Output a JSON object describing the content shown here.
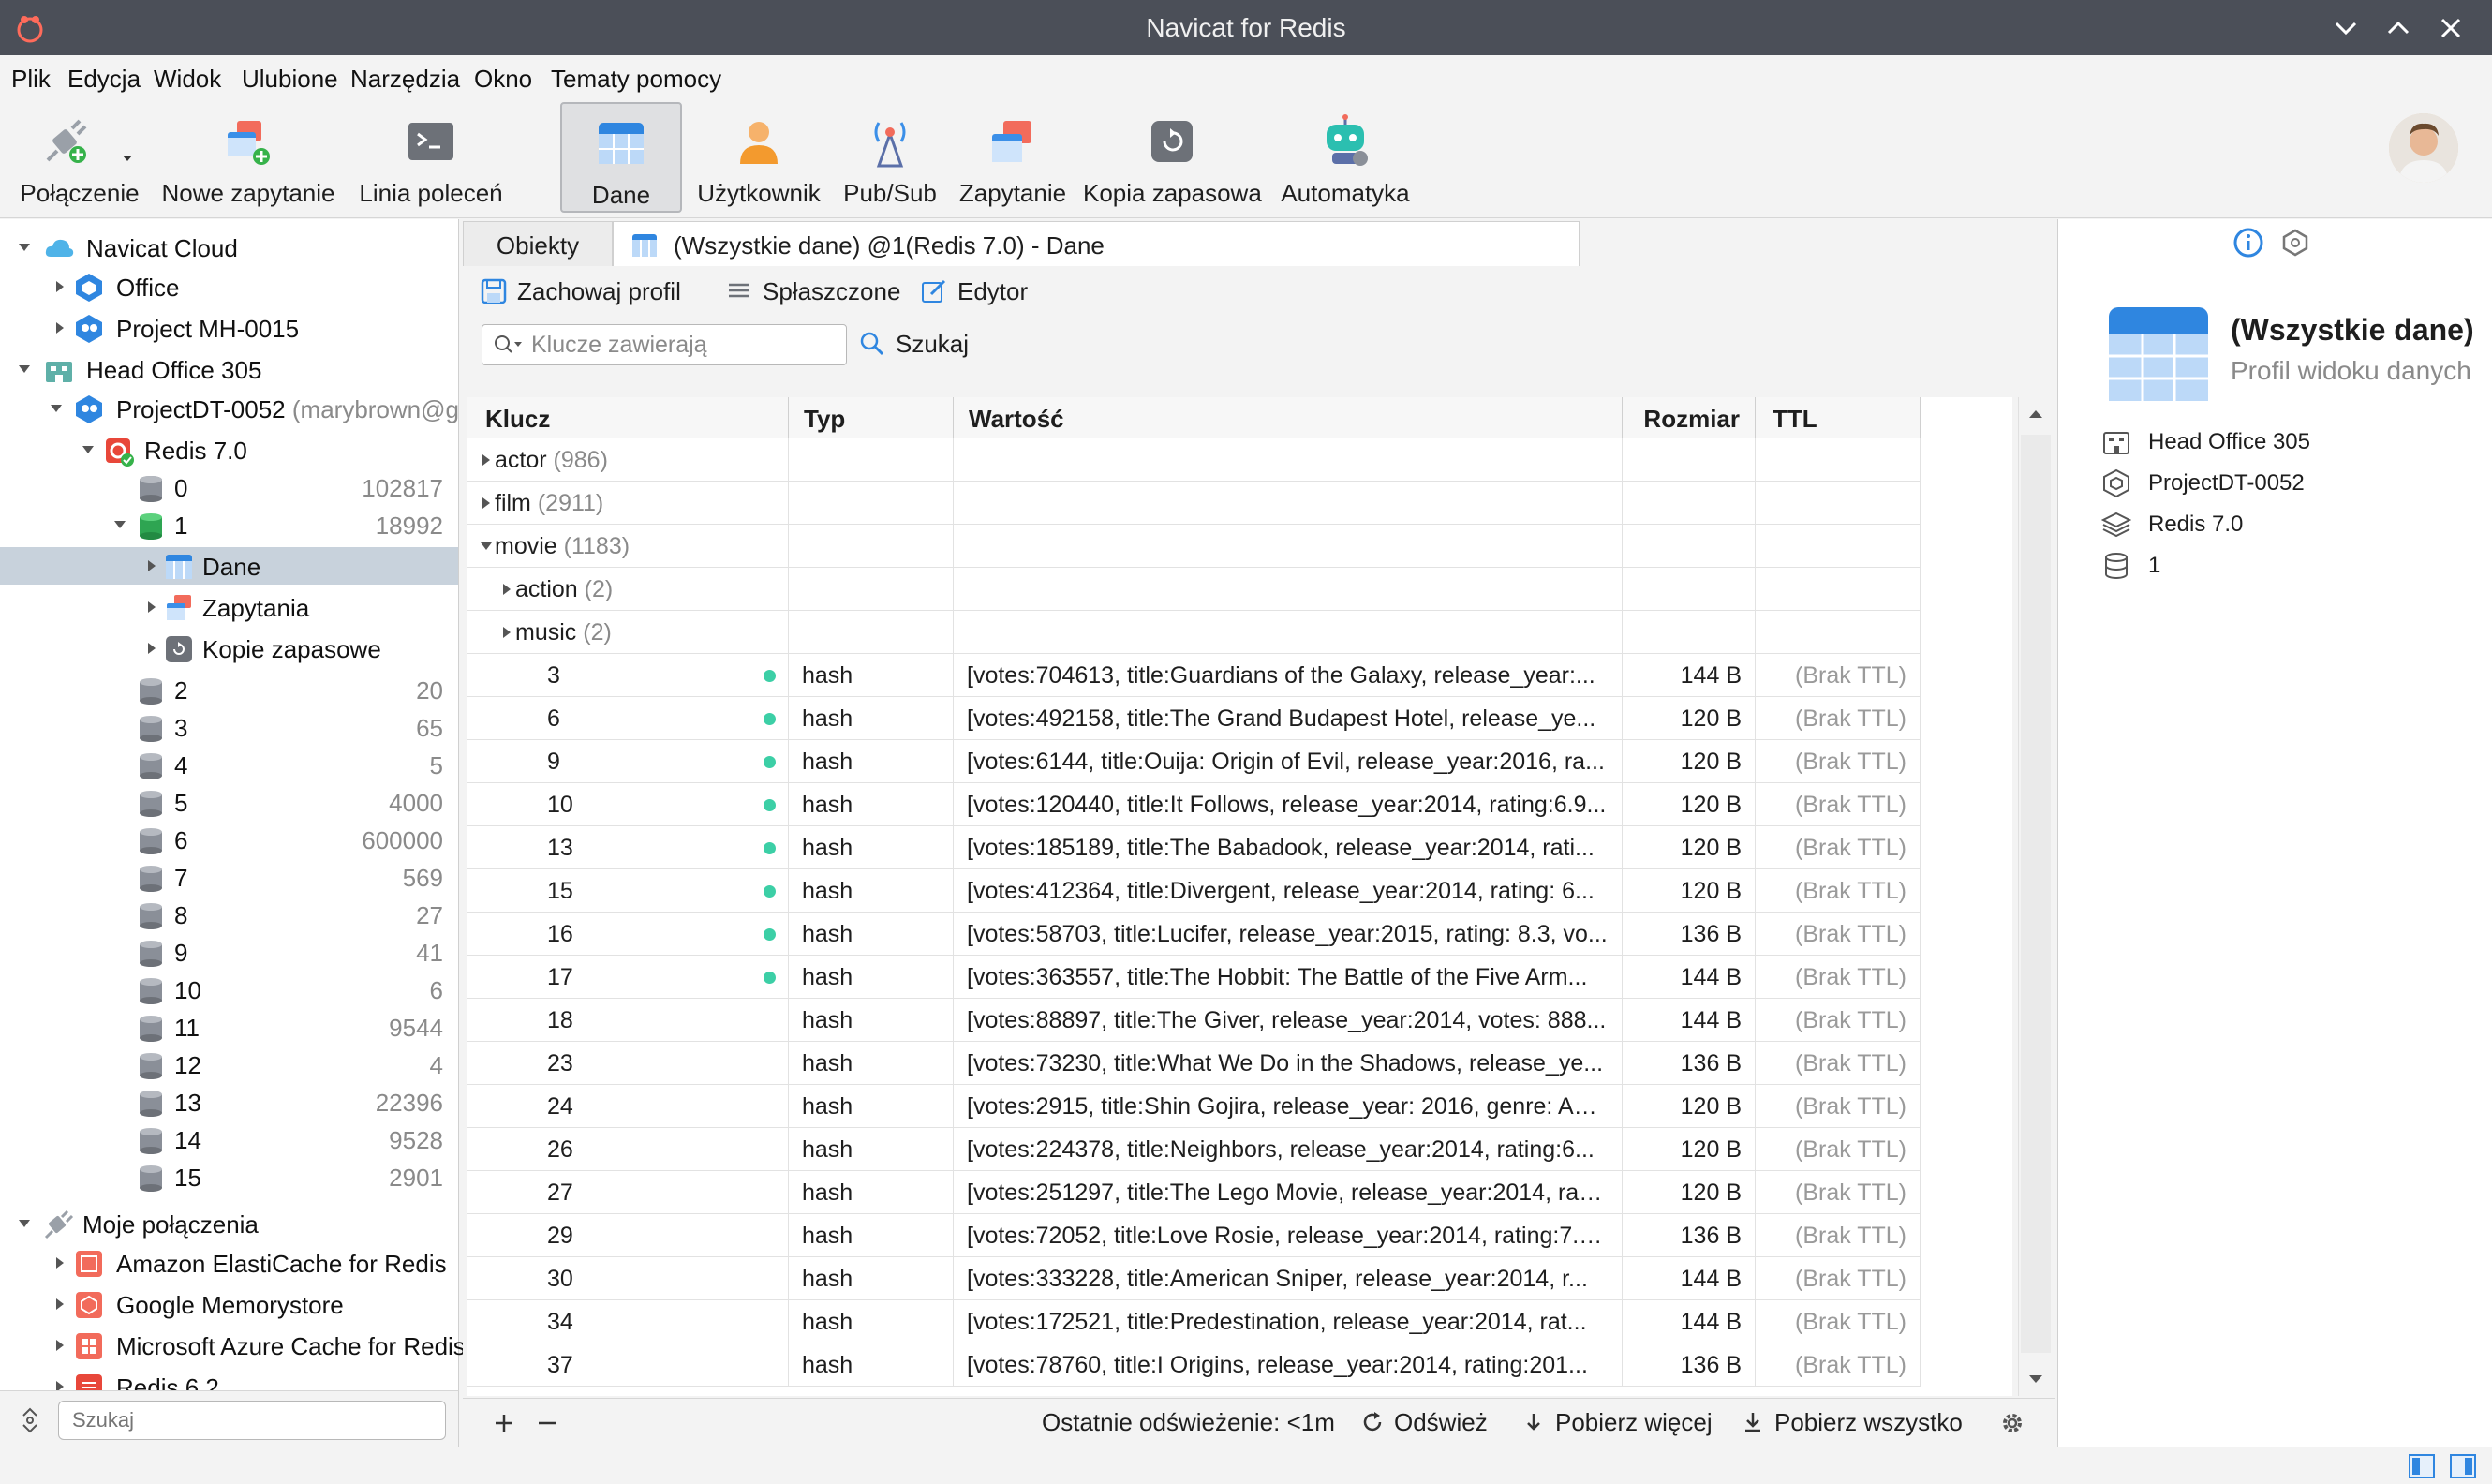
{
  "window": {
    "title": "Navicat for Redis"
  },
  "menu": [
    "Plik",
    "Edycja",
    "Widok",
    "Ulubione",
    "Narzędzia",
    "Okno",
    "Tematy pomocy"
  ],
  "toolbar": {
    "connection": "Połączenie",
    "new_query": "Nowe zapytanie",
    "console": "Linia poleceń",
    "data": "Dane",
    "user": "Użytkownik",
    "pubsub": "Pub/Sub",
    "query": "Zapytanie",
    "backup": "Kopia zapasowa",
    "automation": "Automatyka"
  },
  "nav": {
    "cloud": "Navicat Cloud",
    "office": "Office",
    "project_mh": "Project MH-0015",
    "head_office": "Head Office 305",
    "project_dt": "ProjectDT-0052",
    "project_dt_user": "(marybrown@g",
    "redis7": "Redis 7.0",
    "db0": {
      "name": "0",
      "count": "102817"
    },
    "db1": {
      "name": "1",
      "count": "18992"
    },
    "dane": "Dane",
    "zapytania": "Zapytania",
    "kopie": "Kopie zapasowe",
    "dbs": [
      {
        "name": "2",
        "count": "20"
      },
      {
        "name": "3",
        "count": "65"
      },
      {
        "name": "4",
        "count": "5"
      },
      {
        "name": "5",
        "count": "4000"
      },
      {
        "name": "6",
        "count": "600000"
      },
      {
        "name": "7",
        "count": "569"
      },
      {
        "name": "8",
        "count": "27"
      },
      {
        "name": "9",
        "count": "41"
      },
      {
        "name": "10",
        "count": "6"
      },
      {
        "name": "11",
        "count": "9544"
      },
      {
        "name": "12",
        "count": "4"
      },
      {
        "name": "13",
        "count": "22396"
      },
      {
        "name": "14",
        "count": "9528"
      },
      {
        "name": "15",
        "count": "2901"
      }
    ],
    "my_connections": "Moje połączenia",
    "conns": [
      "Amazon ElastiCache for Redis",
      "Google Memorystore",
      "Microsoft Azure Cache for Redis",
      "Redis 6.2"
    ],
    "search_placeholder": "Szukaj"
  },
  "tabs": {
    "objects": "Obiekty",
    "data_tab": "(Wszystkie dane) @1(Redis 7.0) - Dane"
  },
  "subtoolbar": {
    "save_profile": "Zachowaj profil",
    "flattened": "Spłaszczone",
    "editor": "Edytor"
  },
  "search": {
    "placeholder": "Klucze zawierają",
    "button": "Szukaj"
  },
  "table": {
    "headers": {
      "key": "Klucz",
      "type": "Typ",
      "value": "Wartość",
      "size": "Rozmiar",
      "ttl": "TTL"
    },
    "groups": [
      {
        "name": "actor",
        "count": "(986)"
      },
      {
        "name": "film",
        "count": "(2911)"
      },
      {
        "name": "movie",
        "count": "(1183)"
      }
    ],
    "subgroups": [
      {
        "name": "action",
        "count": "(2)"
      },
      {
        "name": "music",
        "count": "(2)"
      }
    ],
    "rows": [
      {
        "key": "3",
        "type": "hash",
        "value": "[votes:704613, title:Guardians of the Galaxy, release_year:...",
        "size": "144 B",
        "ttl": "(Brak TTL)",
        "dot": true
      },
      {
        "key": "6",
        "type": "hash",
        "value": "[votes:492158, title:The Grand Budapest Hotel, release_ye...",
        "size": "120 B",
        "ttl": "(Brak TTL)",
        "dot": true
      },
      {
        "key": "9",
        "type": "hash",
        "value": "[votes:6144, title:Ouija: Origin of Evil, release_year:2016, ra...",
        "size": "120 B",
        "ttl": "(Brak TTL)",
        "dot": true
      },
      {
        "key": "10",
        "type": "hash",
        "value": "[votes:120440, title:It Follows, release_year:2014, rating:6.9...",
        "size": "120 B",
        "ttl": "(Brak TTL)",
        "dot": true
      },
      {
        "key": "13",
        "type": "hash",
        "value": "[votes:185189, title:The Babadook, release_year:2014, rati...",
        "size": "120 B",
        "ttl": "(Brak TTL)",
        "dot": true
      },
      {
        "key": "15",
        "type": "hash",
        "value": "[votes:412364, title:Divergent, release_year:2014, rating: 6...",
        "size": "120 B",
        "ttl": "(Brak TTL)",
        "dot": true
      },
      {
        "key": "16",
        "type": "hash",
        "value": "[votes:58703, title:Lucifer, release_year:2015, rating: 8.3, vo...",
        "size": "136 B",
        "ttl": "(Brak TTL)",
        "dot": true
      },
      {
        "key": "17",
        "type": "hash",
        "value": "[votes:363557, title:The Hobbit: The Battle of the Five Arm...",
        "size": "144 B",
        "ttl": "(Brak TTL)",
        "dot": true
      },
      {
        "key": "18",
        "type": "hash",
        "value": "[votes:88897, title:The Giver, release_year:2014, votes: 888...",
        "size": "144 B",
        "ttl": "(Brak TTL)",
        "dot": false
      },
      {
        "key": "23",
        "type": "hash",
        "value": "[votes:73230, title:What We Do in the Shadows, release_ye...",
        "size": "136 B",
        "ttl": "(Brak TTL)",
        "dot": false
      },
      {
        "key": "24",
        "type": "hash",
        "value": "[votes:2915, title:Shin Gojira, release_year: 2016, genre: Act...",
        "size": "120 B",
        "ttl": "(Brak TTL)",
        "dot": false
      },
      {
        "key": "26",
        "type": "hash",
        "value": "[votes:224378, title:Neighbors, release_year:2014, rating:6...",
        "size": "120 B",
        "ttl": "(Brak TTL)",
        "dot": false
      },
      {
        "key": "27",
        "type": "hash",
        "value": "[votes:251297, title:The Lego Movie, release_year:2014, rati...",
        "size": "120 B",
        "ttl": "(Brak TTL)",
        "dot": false
      },
      {
        "key": "29",
        "type": "hash",
        "value": "[votes:72052, title:Love Rosie, release_year:2014, rating:7.2...",
        "size": "136 B",
        "ttl": "(Brak TTL)",
        "dot": false
      },
      {
        "key": "30",
        "type": "hash",
        "value": "[votes:333228, title:American Sniper, release_year:2014, r...",
        "size": "144 B",
        "ttl": "(Brak TTL)",
        "dot": false
      },
      {
        "key": "34",
        "type": "hash",
        "value": "[votes:172521, title:Predestination, release_year:2014, rat...",
        "size": "144 B",
        "ttl": "(Brak TTL)",
        "dot": false
      },
      {
        "key": "37",
        "type": "hash",
        "value": "[votes:78760, title:I Origins, release_year:2014, rating:201...",
        "size": "136 B",
        "ttl": "(Brak TTL)",
        "dot": false
      }
    ]
  },
  "bottom": {
    "last_refresh": "Ostatnie odświeżenie: <1m",
    "refresh": "Odśwież",
    "fetch_more": "Pobierz więcej",
    "fetch_all": "Pobierz wszystko"
  },
  "info": {
    "title": "(Wszystkie dane)",
    "subtitle": "Profil widoku danych",
    "items": [
      "Head Office 305",
      "ProjectDT-0052",
      "Redis 7.0",
      "1"
    ]
  }
}
